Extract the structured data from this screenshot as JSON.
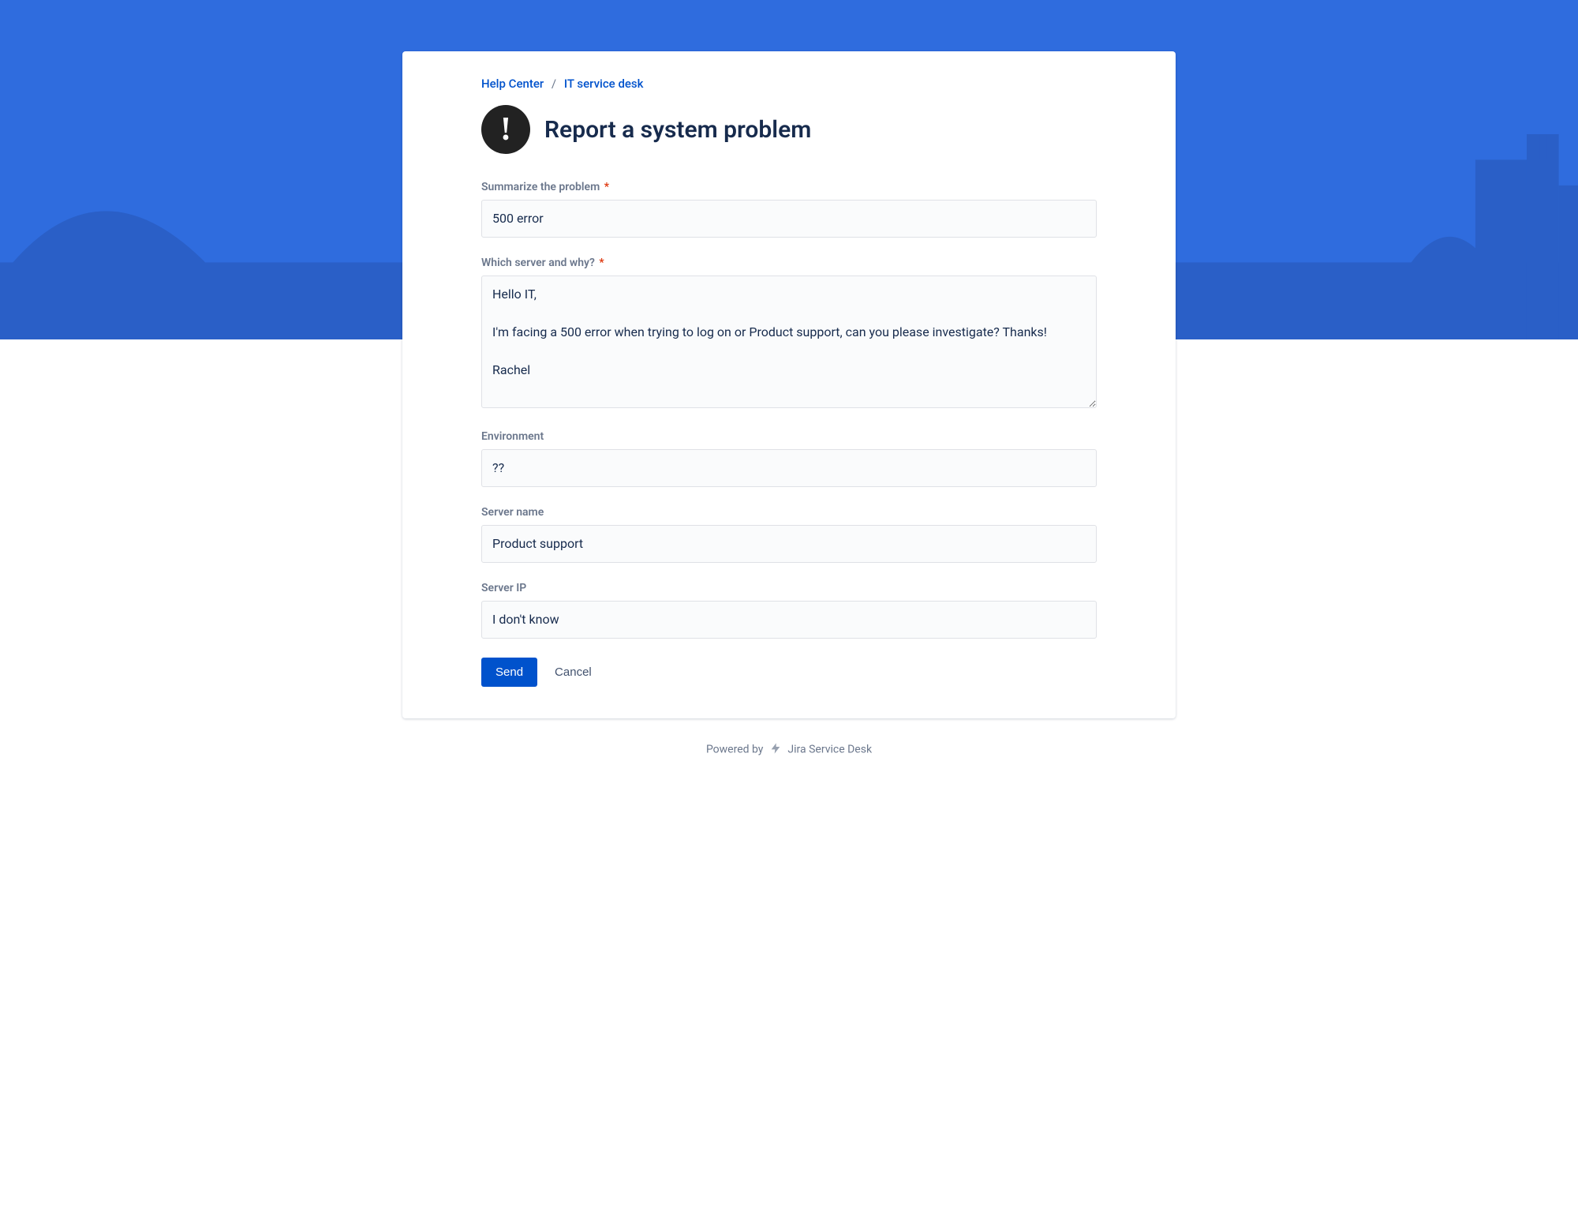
{
  "breadcrumbs": {
    "help_center": "Help Center",
    "service_desk": "IT service desk"
  },
  "page_title": "Report a system problem",
  "icon_name": "exclamation-icon",
  "fields": {
    "summary": {
      "label": "Summarize the problem",
      "required": true,
      "value": "500 error"
    },
    "description": {
      "label": "Which server and why?",
      "required": true,
      "value": "Hello IT,\n\nI'm facing a 500 error when trying to log on or Product support, can you please investigate? Thanks!\n\nRachel"
    },
    "environment": {
      "label": "Environment",
      "required": false,
      "value": "??"
    },
    "server_name": {
      "label": "Server name",
      "required": false,
      "value": "Product support"
    },
    "server_ip": {
      "label": "Server IP",
      "required": false,
      "value": "I don't know"
    }
  },
  "actions": {
    "send": "Send",
    "cancel": "Cancel"
  },
  "footer": {
    "powered_by": "Powered by",
    "brand": "Jira Service Desk"
  },
  "required_marker": "*"
}
